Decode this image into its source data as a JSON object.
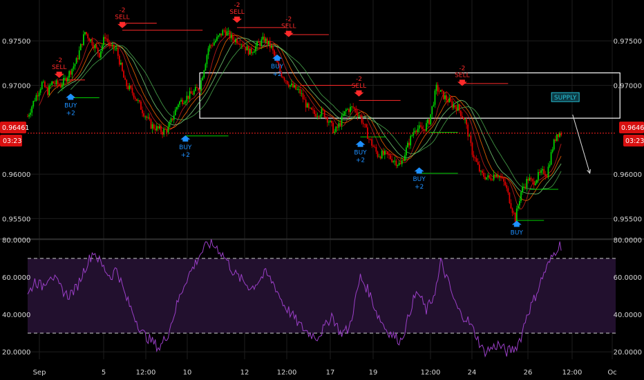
{
  "colors": {
    "background": "#000000",
    "grid": "#1e1e1e",
    "up": "#00d200",
    "down": "#e00000",
    "buy": "#1e90ff",
    "sell": "#ff2a2a",
    "price_line": "#ff2020",
    "rsi_line": "#9b3fc8",
    "rsi_band": "#22102e",
    "rsi_level": "#cfcfcf",
    "supply_box": "#ffffff",
    "supply_label": "#27c3d9"
  },
  "price_axis": {
    "ticks": [
      "0.97500",
      "0.97000",
      "0.96000",
      "0.95500"
    ],
    "current_price": "0.96461",
    "countdown": "03:23"
  },
  "rsi_axis": {
    "ticks": [
      "80.0000",
      "60.0000",
      "40.0000",
      "20.0000"
    ]
  },
  "time_axis": {
    "ticks": [
      "Sep",
      "5",
      "12:00",
      "10",
      "12",
      "12:00",
      "17",
      "19",
      "12:00",
      "24",
      "26",
      "12:00",
      "Oc"
    ]
  },
  "supply_label": "SUPPLY",
  "chart_data": [
    {
      "type": "candlestick",
      "title": "",
      "ylim": [
        0.9527,
        0.9796
      ],
      "current_price": 0.96461,
      "price_path": [
        [
          0.9665,
          0
        ],
        [
          0.9685,
          5
        ],
        [
          0.9695,
          8
        ],
        [
          0.9702,
          10
        ],
        [
          0.9693,
          14
        ],
        [
          0.9703,
          17
        ],
        [
          0.97,
          23
        ],
        [
          0.9706,
          26
        ],
        [
          0.9727,
          34
        ],
        [
          0.976,
          40
        ],
        [
          0.9746,
          46
        ],
        [
          0.9735,
          50
        ],
        [
          0.9756,
          54
        ],
        [
          0.9742,
          58
        ],
        [
          0.974,
          62
        ],
        [
          0.9702,
          68
        ],
        [
          0.969,
          74
        ],
        [
          0.9672,
          80
        ],
        [
          0.9655,
          86
        ],
        [
          0.9648,
          94
        ],
        [
          0.9651,
          98
        ],
        [
          0.968,
          105
        ],
        [
          0.969,
          114
        ],
        [
          0.9698,
          120
        ],
        [
          0.9742,
          126
        ],
        [
          0.9752,
          132
        ],
        [
          0.9762,
          137
        ],
        [
          0.9752,
          143
        ],
        [
          0.975,
          148
        ],
        [
          0.9737,
          155
        ],
        [
          0.9745,
          160
        ],
        [
          0.9752,
          165
        ],
        [
          0.9742,
          170
        ],
        [
          0.9715,
          176
        ],
        [
          0.97,
          183
        ],
        [
          0.9692,
          190
        ],
        [
          0.9672,
          196
        ],
        [
          0.9668,
          200
        ],
        [
          0.967,
          206
        ],
        [
          0.966,
          210
        ],
        [
          0.9647,
          214
        ],
        [
          0.9655,
          217
        ],
        [
          0.9672,
          222
        ],
        [
          0.9675,
          227
        ],
        [
          0.9665,
          232
        ],
        [
          0.964,
          238
        ],
        [
          0.9622,
          244
        ],
        [
          0.9622,
          250
        ],
        [
          0.9615,
          256
        ],
        [
          0.961,
          260
        ],
        [
          0.9628,
          264
        ],
        [
          0.9652,
          270
        ],
        [
          0.965,
          276
        ],
        [
          0.966,
          280
        ],
        [
          0.9697,
          285
        ],
        [
          0.9688,
          290
        ],
        [
          0.9678,
          296
        ],
        [
          0.9675,
          300
        ],
        [
          0.966,
          305
        ],
        [
          0.9625,
          310
        ],
        [
          0.96,
          316
        ],
        [
          0.9595,
          322
        ],
        [
          0.9602,
          327
        ],
        [
          0.9588,
          333
        ],
        [
          0.956,
          338
        ],
        [
          0.955,
          340
        ],
        [
          0.958,
          344
        ],
        [
          0.9595,
          349
        ],
        [
          0.959,
          352
        ],
        [
          0.9598,
          356
        ],
        [
          0.9603,
          360
        ],
        [
          0.96,
          362
        ],
        [
          0.963,
          366
        ],
        [
          0.9646,
          369
        ]
      ],
      "signals": [
        {
          "type": "sell",
          "label": "SELL",
          "value": "-2",
          "x": 22,
          "price": 0.9706
        },
        {
          "type": "buy",
          "label": "BUY",
          "value": "+2",
          "x": 30,
          "price": 0.9693
        },
        {
          "type": "sell",
          "label": "SELL",
          "value": "-2",
          "x": 66,
          "price": 0.9762
        },
        {
          "type": "buy",
          "label": "BUY",
          "value": "+2",
          "x": 110,
          "price": 0.9646
        },
        {
          "type": "sell",
          "label": "SELL",
          "value": "-2",
          "x": 146,
          "price": 0.9768
        },
        {
          "type": "buy",
          "label": "BUY",
          "value": "+2",
          "x": 174,
          "price": 0.9737
        },
        {
          "type": "sell",
          "label": "SELL",
          "value": "-2",
          "x": 182,
          "price": 0.9752
        },
        {
          "type": "sell",
          "label": "SELL",
          "value": "-2",
          "x": 231,
          "price": 0.9685
        },
        {
          "type": "buy",
          "label": "BUY",
          "value": "+2",
          "x": 232,
          "price": 0.964
        },
        {
          "type": "buy",
          "label": "BUY",
          "value": "+2",
          "x": 273,
          "price": 0.961
        },
        {
          "type": "sell",
          "label": "SELL",
          "value": "-2",
          "x": 303,
          "price": 0.9697
        },
        {
          "type": "buy",
          "label": "BUY",
          "value": "",
          "x": 341,
          "price": 0.955
        }
      ],
      "signal_levels": [
        {
          "type": "sell",
          "x": [
            22,
            40
          ],
          "price": 0.9706
        },
        {
          "type": "buy",
          "x": [
            30,
            50
          ],
          "price": 0.9686
        },
        {
          "type": "sell",
          "x": [
            66,
            90
          ],
          "price": 0.977
        },
        {
          "type": "sell",
          "x": [
            66,
            122
          ],
          "price": 0.9762
        },
        {
          "type": "buy",
          "x": [
            110,
            140
          ],
          "price": 0.9643
        },
        {
          "type": "sell",
          "x": [
            146,
            180
          ],
          "price": 0.9765
        },
        {
          "type": "sell",
          "x": [
            182,
            210
          ],
          "price": 0.9757
        },
        {
          "type": "sell",
          "x": [
            190,
            230
          ],
          "price": 0.97
        },
        {
          "type": "sell",
          "x": [
            231,
            260
          ],
          "price": 0.9683
        },
        {
          "type": "buy",
          "x": [
            232,
            250
          ],
          "price": 0.9642
        },
        {
          "type": "buy",
          "x": [
            273,
            300
          ],
          "price": 0.9601
        },
        {
          "type": "buy",
          "x": [
            280,
            300
          ],
          "price": 0.9647
        },
        {
          "type": "sell",
          "x": [
            303,
            335
          ],
          "price": 0.9702
        },
        {
          "type": "buy",
          "x": [
            341,
            360
          ],
          "price": 0.9548
        },
        {
          "type": "buy",
          "x": [
            350,
            370
          ],
          "price": 0.9583
        }
      ],
      "supply_zone": {
        "x": [
          120,
          413
        ],
        "price": [
          0.9663,
          0.9714
        ]
      },
      "projection_arrow": {
        "from": [
          380,
          0.9667
        ],
        "to": [
          392,
          0.9601
        ]
      }
    },
    {
      "type": "line",
      "title": "",
      "ylim": [
        16,
        80
      ],
      "levels": [
        70,
        30
      ],
      "rsi_path": [
        [
          50,
          0
        ],
        [
          58,
          5
        ],
        [
          55,
          10
        ],
        [
          62,
          16
        ],
        [
          55,
          22
        ],
        [
          50,
          28
        ],
        [
          54,
          34
        ],
        [
          65,
          40
        ],
        [
          74,
          46
        ],
        [
          66,
          52
        ],
        [
          60,
          58
        ],
        [
          65,
          62
        ],
        [
          50,
          68
        ],
        [
          40,
          74
        ],
        [
          30,
          80
        ],
        [
          26,
          86
        ],
        [
          22,
          92
        ],
        [
          30,
          98
        ],
        [
          45,
          104
        ],
        [
          58,
          110
        ],
        [
          66,
          116
        ],
        [
          72,
          120
        ],
        [
          78,
          126
        ],
        [
          76,
          132
        ],
        [
          70,
          138
        ],
        [
          62,
          144
        ],
        [
          58,
          150
        ],
        [
          54,
          156
        ],
        [
          59,
          162
        ],
        [
          62,
          166
        ],
        [
          56,
          172
        ],
        [
          46,
          178
        ],
        [
          40,
          184
        ],
        [
          34,
          190
        ],
        [
          30,
          196
        ],
        [
          28,
          202
        ],
        [
          34,
          208
        ],
        [
          40,
          212
        ],
        [
          30,
          218
        ],
        [
          32,
          224
        ],
        [
          46,
          228
        ],
        [
          60,
          232
        ],
        [
          52,
          238
        ],
        [
          40,
          244
        ],
        [
          32,
          250
        ],
        [
          28,
          256
        ],
        [
          26,
          260
        ],
        [
          34,
          264
        ],
        [
          46,
          268
        ],
        [
          52,
          272
        ],
        [
          42,
          278
        ],
        [
          48,
          282
        ],
        [
          58,
          286
        ],
        [
          68,
          288
        ],
        [
          60,
          292
        ],
        [
          46,
          298
        ],
        [
          40,
          302
        ],
        [
          38,
          306
        ],
        [
          30,
          312
        ],
        [
          20,
          318
        ],
        [
          22,
          324
        ],
        [
          24,
          328
        ],
        [
          20,
          334
        ],
        [
          22,
          340
        ],
        [
          28,
          344
        ],
        [
          40,
          348
        ],
        [
          46,
          352
        ],
        [
          54,
          356
        ],
        [
          62,
          360
        ],
        [
          68,
          364
        ],
        [
          74,
          368
        ],
        [
          77,
          370
        ]
      ]
    }
  ]
}
